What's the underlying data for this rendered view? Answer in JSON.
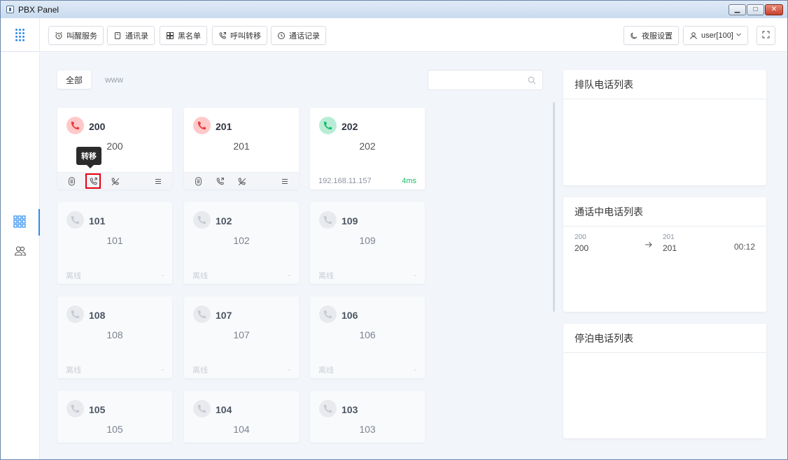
{
  "window": {
    "title": "PBX Panel"
  },
  "toolbar": {
    "wakeup": "叫醒服务",
    "contacts": "通讯录",
    "blacklist": "黑名单",
    "forward": "呼叫转移",
    "records": "通话记录",
    "night": "夜服设置",
    "user": "user[100]"
  },
  "tabs": {
    "all": "全部",
    "www": "www"
  },
  "search": {
    "placeholder": ""
  },
  "tooltip": "转移",
  "colors": {
    "accent": "#2d8cf0",
    "busy": "#e83d3d",
    "idle": "#19be6b",
    "offline": "#c5cad3"
  },
  "extensions": [
    {
      "number": "200",
      "name": "200",
      "status": "busy"
    },
    {
      "number": "201",
      "name": "201",
      "status": "busy"
    },
    {
      "number": "202",
      "name": "202",
      "status": "idle",
      "ip": "192.168.11.157",
      "latency": "4ms"
    },
    {
      "number": "101",
      "name": "101",
      "status": "offline",
      "state_label": "离线",
      "dash": "-"
    },
    {
      "number": "102",
      "name": "102",
      "status": "offline",
      "state_label": "离线",
      "dash": "-"
    },
    {
      "number": "109",
      "name": "109",
      "status": "offline",
      "state_label": "离线",
      "dash": "-"
    },
    {
      "number": "108",
      "name": "108",
      "status": "offline",
      "state_label": "离线",
      "dash": "-"
    },
    {
      "number": "107",
      "name": "107",
      "status": "offline",
      "state_label": "离线",
      "dash": "-"
    },
    {
      "number": "106",
      "name": "106",
      "status": "offline",
      "state_label": "离线",
      "dash": "-"
    },
    {
      "number": "105",
      "name": "105",
      "status": "offline"
    },
    {
      "number": "104",
      "name": "104",
      "status": "offline"
    },
    {
      "number": "103",
      "name": "103",
      "status": "offline"
    }
  ],
  "panels": {
    "queue": {
      "title": "排队电话列表"
    },
    "active": {
      "title": "通话中电话列表",
      "calls": [
        {
          "from_small": "200",
          "from": "200",
          "to_small": "201",
          "to": "201",
          "duration": "00:12"
        }
      ]
    },
    "parked": {
      "title": "停泊电话列表"
    }
  }
}
